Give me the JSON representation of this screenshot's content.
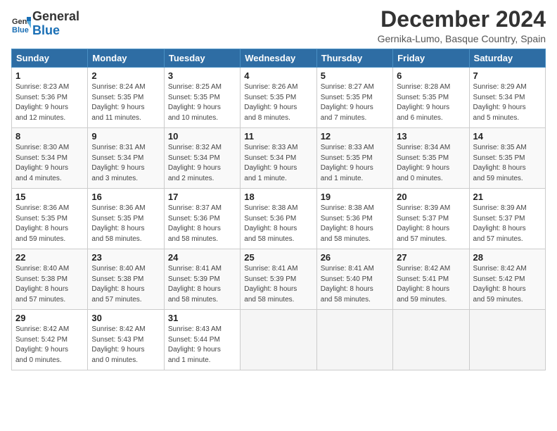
{
  "header": {
    "logo_line1": "General",
    "logo_line2": "Blue",
    "title": "December 2024",
    "subtitle": "Gernika-Lumo, Basque Country, Spain"
  },
  "days_of_week": [
    "Sunday",
    "Monday",
    "Tuesday",
    "Wednesday",
    "Thursday",
    "Friday",
    "Saturday"
  ],
  "weeks": [
    [
      {
        "day": 1,
        "info": "Sunrise: 8:23 AM\nSunset: 5:36 PM\nDaylight: 9 hours\nand 12 minutes."
      },
      {
        "day": 2,
        "info": "Sunrise: 8:24 AM\nSunset: 5:35 PM\nDaylight: 9 hours\nand 11 minutes."
      },
      {
        "day": 3,
        "info": "Sunrise: 8:25 AM\nSunset: 5:35 PM\nDaylight: 9 hours\nand 10 minutes."
      },
      {
        "day": 4,
        "info": "Sunrise: 8:26 AM\nSunset: 5:35 PM\nDaylight: 9 hours\nand 8 minutes."
      },
      {
        "day": 5,
        "info": "Sunrise: 8:27 AM\nSunset: 5:35 PM\nDaylight: 9 hours\nand 7 minutes."
      },
      {
        "day": 6,
        "info": "Sunrise: 8:28 AM\nSunset: 5:35 PM\nDaylight: 9 hours\nand 6 minutes."
      },
      {
        "day": 7,
        "info": "Sunrise: 8:29 AM\nSunset: 5:34 PM\nDaylight: 9 hours\nand 5 minutes."
      }
    ],
    [
      {
        "day": 8,
        "info": "Sunrise: 8:30 AM\nSunset: 5:34 PM\nDaylight: 9 hours\nand 4 minutes."
      },
      {
        "day": 9,
        "info": "Sunrise: 8:31 AM\nSunset: 5:34 PM\nDaylight: 9 hours\nand 3 minutes."
      },
      {
        "day": 10,
        "info": "Sunrise: 8:32 AM\nSunset: 5:34 PM\nDaylight: 9 hours\nand 2 minutes."
      },
      {
        "day": 11,
        "info": "Sunrise: 8:33 AM\nSunset: 5:34 PM\nDaylight: 9 hours\nand 1 minute."
      },
      {
        "day": 12,
        "info": "Sunrise: 8:33 AM\nSunset: 5:35 PM\nDaylight: 9 hours\nand 1 minute."
      },
      {
        "day": 13,
        "info": "Sunrise: 8:34 AM\nSunset: 5:35 PM\nDaylight: 9 hours\nand 0 minutes."
      },
      {
        "day": 14,
        "info": "Sunrise: 8:35 AM\nSunset: 5:35 PM\nDaylight: 8 hours\nand 59 minutes."
      }
    ],
    [
      {
        "day": 15,
        "info": "Sunrise: 8:36 AM\nSunset: 5:35 PM\nDaylight: 8 hours\nand 59 minutes."
      },
      {
        "day": 16,
        "info": "Sunrise: 8:36 AM\nSunset: 5:35 PM\nDaylight: 8 hours\nand 58 minutes."
      },
      {
        "day": 17,
        "info": "Sunrise: 8:37 AM\nSunset: 5:36 PM\nDaylight: 8 hours\nand 58 minutes."
      },
      {
        "day": 18,
        "info": "Sunrise: 8:38 AM\nSunset: 5:36 PM\nDaylight: 8 hours\nand 58 minutes."
      },
      {
        "day": 19,
        "info": "Sunrise: 8:38 AM\nSunset: 5:36 PM\nDaylight: 8 hours\nand 58 minutes."
      },
      {
        "day": 20,
        "info": "Sunrise: 8:39 AM\nSunset: 5:37 PM\nDaylight: 8 hours\nand 57 minutes."
      },
      {
        "day": 21,
        "info": "Sunrise: 8:39 AM\nSunset: 5:37 PM\nDaylight: 8 hours\nand 57 minutes."
      }
    ],
    [
      {
        "day": 22,
        "info": "Sunrise: 8:40 AM\nSunset: 5:38 PM\nDaylight: 8 hours\nand 57 minutes."
      },
      {
        "day": 23,
        "info": "Sunrise: 8:40 AM\nSunset: 5:38 PM\nDaylight: 8 hours\nand 57 minutes."
      },
      {
        "day": 24,
        "info": "Sunrise: 8:41 AM\nSunset: 5:39 PM\nDaylight: 8 hours\nand 58 minutes."
      },
      {
        "day": 25,
        "info": "Sunrise: 8:41 AM\nSunset: 5:39 PM\nDaylight: 8 hours\nand 58 minutes."
      },
      {
        "day": 26,
        "info": "Sunrise: 8:41 AM\nSunset: 5:40 PM\nDaylight: 8 hours\nand 58 minutes."
      },
      {
        "day": 27,
        "info": "Sunrise: 8:42 AM\nSunset: 5:41 PM\nDaylight: 8 hours\nand 59 minutes."
      },
      {
        "day": 28,
        "info": "Sunrise: 8:42 AM\nSunset: 5:42 PM\nDaylight: 8 hours\nand 59 minutes."
      }
    ],
    [
      {
        "day": 29,
        "info": "Sunrise: 8:42 AM\nSunset: 5:42 PM\nDaylight: 9 hours\nand 0 minutes."
      },
      {
        "day": 30,
        "info": "Sunrise: 8:42 AM\nSunset: 5:43 PM\nDaylight: 9 hours\nand 0 minutes."
      },
      {
        "day": 31,
        "info": "Sunrise: 8:43 AM\nSunset: 5:44 PM\nDaylight: 9 hours\nand 1 minute."
      },
      null,
      null,
      null,
      null
    ]
  ]
}
